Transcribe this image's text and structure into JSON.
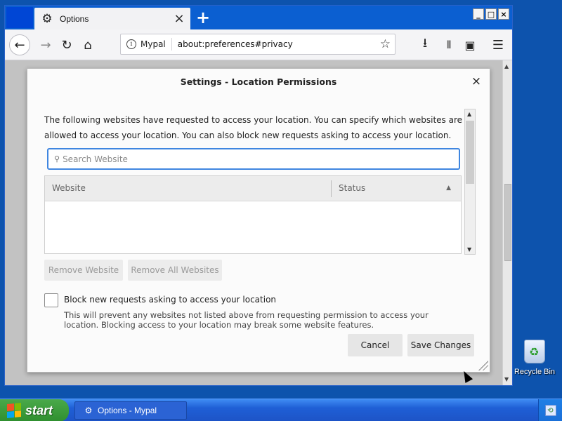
{
  "browser": {
    "tab": {
      "title": "Options",
      "icon": "gear-icon"
    },
    "window_buttons": {
      "minimize": "_",
      "maximize": "□",
      "close": "×"
    },
    "toolbar": {
      "site_name": "Mypal",
      "url": "about:preferences#privacy"
    }
  },
  "dialog": {
    "title": "Settings - Location Permissions",
    "description": "The following websites have requested to access your location. You can specify which websites are allowed to access your location. You can also block new requests asking to access your location.",
    "search": {
      "placeholder": "Search Website",
      "value": ""
    },
    "table": {
      "columns": [
        "Website",
        "Status"
      ],
      "rows": []
    },
    "buttons": {
      "remove_website": "Remove Website",
      "remove_all": "Remove All Websites",
      "cancel": "Cancel",
      "save": "Save Changes"
    },
    "block_checkbox": {
      "label": "Block new requests asking to access your location",
      "checked": false,
      "note": "This will prevent any websites not listed above from requesting permission to access your location. Blocking access to your location may break some website features."
    }
  },
  "desktop": {
    "icons": [
      {
        "label": "Recycle Bin",
        "icon": "recycle-bin-icon"
      }
    ]
  },
  "taskbar": {
    "start_label": "start",
    "task_item": "Options - Mypal"
  },
  "colors": {
    "desktop": "#0d53ad",
    "tabbar": "#0b5fd1",
    "focus_ring": "#3f86e0",
    "start_button": "#3a9b3a"
  }
}
